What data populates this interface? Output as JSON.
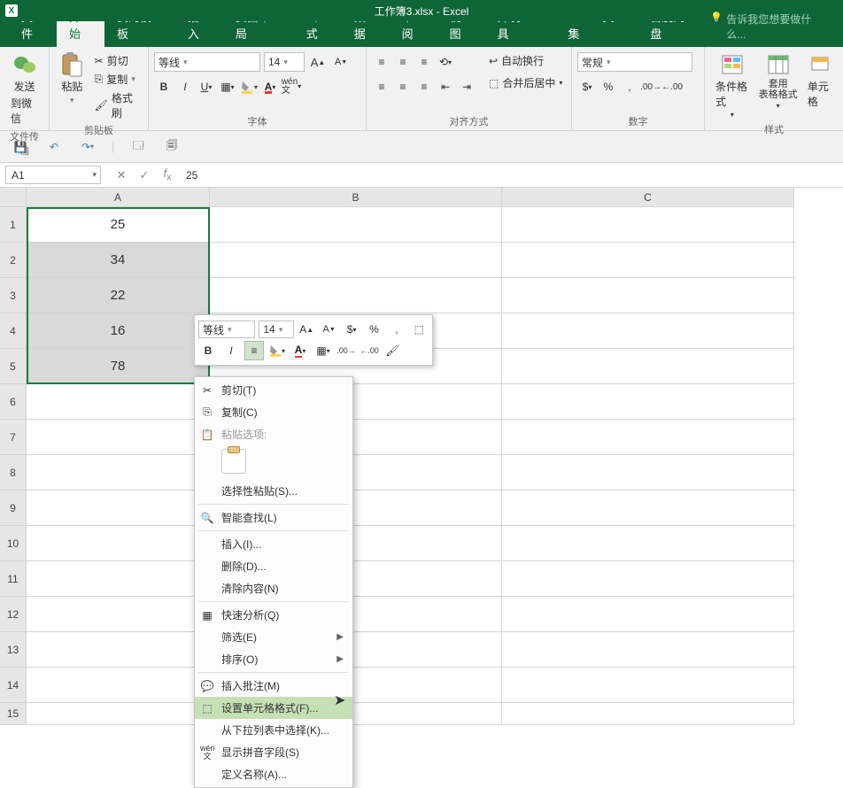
{
  "title": "工作簿3.xlsx - Excel",
  "tabs": [
    "文件",
    "开始",
    "我的模板",
    "插入",
    "页面布局",
    "公式",
    "数据",
    "审阅",
    "视图",
    "开发工具",
    "PDF工具集",
    "百度网盘"
  ],
  "tell_me": "告诉我您想要做什么...",
  "groups": {
    "wechat": {
      "send": "发送",
      "to": "到微信",
      "label": "文件传输"
    },
    "clipboard": {
      "paste": "粘贴",
      "cut": "剪切",
      "copy": "复制",
      "format_painter": "格式刷",
      "label": "剪贴板"
    },
    "font": {
      "name": "等线",
      "size": "14",
      "label": "字体"
    },
    "align": {
      "wrap": "自动换行",
      "merge": "合并后居中",
      "label": "对齐方式"
    },
    "number": {
      "format": "常规",
      "label": "数字"
    },
    "styles": {
      "cond": "条件格式",
      "table": "套用\n表格格式",
      "cell": "单元格",
      "label": "样式"
    }
  },
  "name_box": "A1",
  "formula": "25",
  "columns": [
    "A",
    "B",
    "C"
  ],
  "rows": [
    "1",
    "2",
    "3",
    "4",
    "5",
    "6",
    "7",
    "8",
    "9",
    "10",
    "11",
    "12",
    "13",
    "14",
    "15"
  ],
  "cells": {
    "A1": "25",
    "A2": "34",
    "A3": "22",
    "A4": "16",
    "A5": "78"
  },
  "chart_data": {
    "type": "table",
    "title": "",
    "columns": [
      "A"
    ],
    "values": [
      25,
      34,
      22,
      16,
      78
    ]
  },
  "mini": {
    "font": "等线",
    "size": "14"
  },
  "context_menu": {
    "cut": "剪切(T)",
    "copy": "复制(C)",
    "paste_options": "粘贴选项:",
    "paste_special": "选择性粘贴(S)...",
    "smart_lookup": "智能查找(L)",
    "insert": "插入(I)...",
    "delete": "删除(D)...",
    "clear": "清除内容(N)",
    "quick_analysis": "快速分析(Q)",
    "filter": "筛选(E)",
    "sort": "排序(O)",
    "insert_comment": "插入批注(M)",
    "format_cells": "设置单元格格式(F)...",
    "dropdown": "从下拉列表中选择(K)...",
    "pinyin": "显示拼音字段(S)",
    "define_name": "定义名称(A)..."
  }
}
